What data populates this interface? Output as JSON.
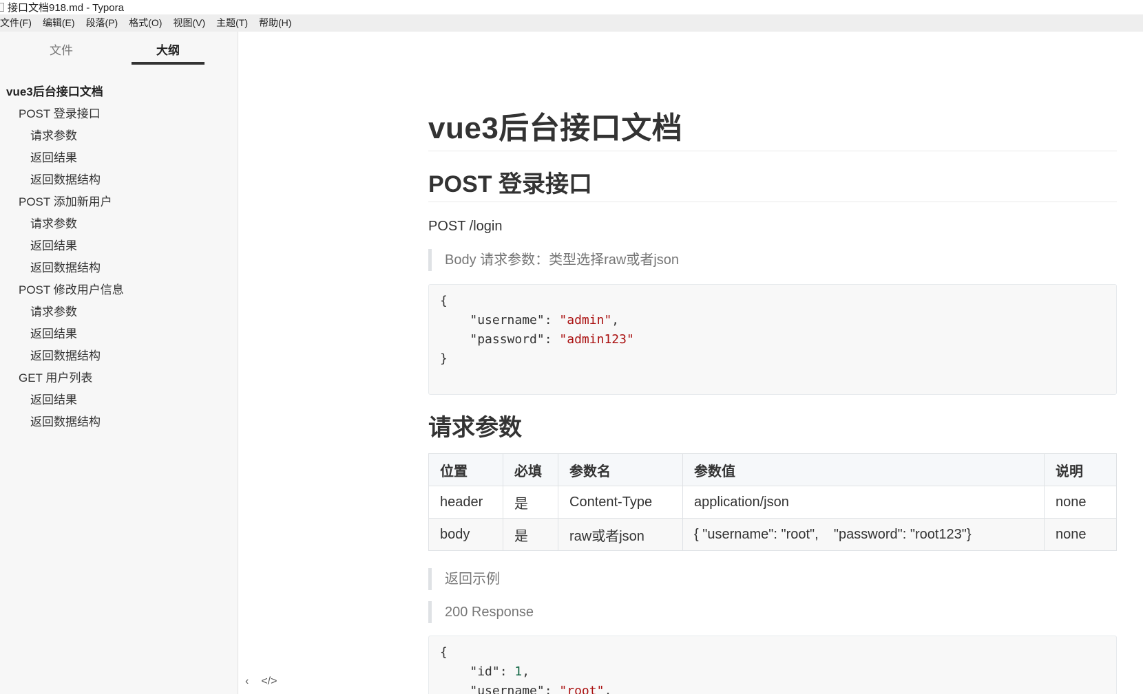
{
  "window": {
    "title": "接口文档918.md - Typora"
  },
  "menubar": {
    "items": [
      "文件(F)",
      "编辑(E)",
      "段落(P)",
      "格式(O)",
      "视图(V)",
      "主题(T)",
      "帮助(H)"
    ]
  },
  "sidebar": {
    "tabs": {
      "files": "文件",
      "outline": "大纲"
    },
    "active_tab": "outline",
    "outline": [
      {
        "level": 1,
        "label": "vue3后台接口文档"
      },
      {
        "level": 2,
        "label": "POST 登录接口"
      },
      {
        "level": 3,
        "label": "请求参数"
      },
      {
        "level": 3,
        "label": "返回结果"
      },
      {
        "level": 3,
        "label": "返回数据结构"
      },
      {
        "level": 2,
        "label": "POST 添加新用户"
      },
      {
        "level": 3,
        "label": "请求参数"
      },
      {
        "level": 3,
        "label": "返回结果"
      },
      {
        "level": 3,
        "label": "返回数据结构"
      },
      {
        "level": 2,
        "label": "POST 修改用户信息"
      },
      {
        "level": 3,
        "label": "请求参数"
      },
      {
        "level": 3,
        "label": "返回结果"
      },
      {
        "level": 3,
        "label": "返回数据结构"
      },
      {
        "level": 2,
        "label": "GET 用户列表"
      },
      {
        "level": 3,
        "label": "返回结果"
      },
      {
        "level": 3,
        "label": "返回数据结构"
      }
    ],
    "footer": {
      "collapse_glyph": "‹",
      "source_glyph": "</>"
    }
  },
  "content": {
    "h1": "vue3后台接口文档",
    "h2_login": "POST 登录接口",
    "endpoint": "POST /login",
    "blockquote_body": "Body 请求参数：类型选择raw或者json",
    "code1": {
      "open": "{",
      "k1": "\"username\"",
      "v1": "\"admin\"",
      "k2": "\"password\"",
      "v2": "\"admin123\"",
      "close": "}"
    },
    "h3_params": "请求参数",
    "table": {
      "headers": [
        "位置",
        "必填",
        "参数名",
        "参数值",
        "说明"
      ],
      "rows": [
        [
          "header",
          "是",
          "Content-Type",
          "application/json",
          "none"
        ],
        [
          "body",
          "是",
          "raw或者json",
          "{ \"username\": \"root\",    \"password\": \"root123\"}",
          "none"
        ]
      ]
    },
    "blockquote_return": "返回示例",
    "blockquote_response": "200 Response",
    "code2": {
      "open": "{",
      "k1": "\"id\"",
      "v1": "1",
      "k2": "\"username\"",
      "v2": "\"root\""
    }
  },
  "colors": {
    "string": "#aa1111",
    "number": "#116644",
    "sidebar_bg": "#f7f7f7",
    "menubar_bg": "#eeeeee"
  }
}
